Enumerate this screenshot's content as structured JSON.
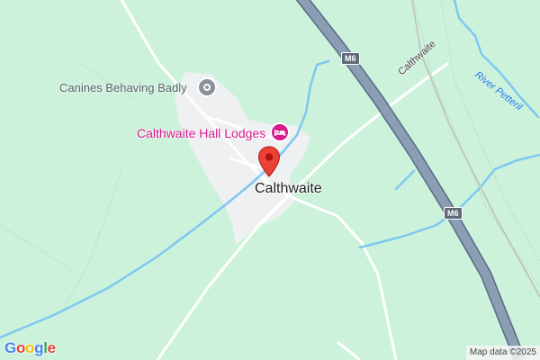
{
  "map": {
    "place_label": "Calthwaite",
    "points_of_interest": [
      {
        "name": "Canines Behaving Badly",
        "icon": "place-pin-icon",
        "color": "#5f6368"
      },
      {
        "name": "Calthwaite Hall Lodges",
        "icon": "hotel-bed-icon",
        "color": "#d81a8c"
      }
    ],
    "road_label": "Calthwaite",
    "motorway_shields": [
      "M6",
      "M6"
    ],
    "river_label": "River Petteril",
    "marker_icon": "red-location-pin-icon",
    "colors": {
      "land": "#cdf2dc",
      "water": "#7ec8f0",
      "motorway": "#8c9eb3",
      "settlement": "#eef0f1",
      "marker": "#ea4335"
    }
  },
  "footer": {
    "logo_letters": [
      "G",
      "o",
      "o",
      "g",
      "l",
      "e"
    ],
    "attribution": "Map data ©2025"
  }
}
